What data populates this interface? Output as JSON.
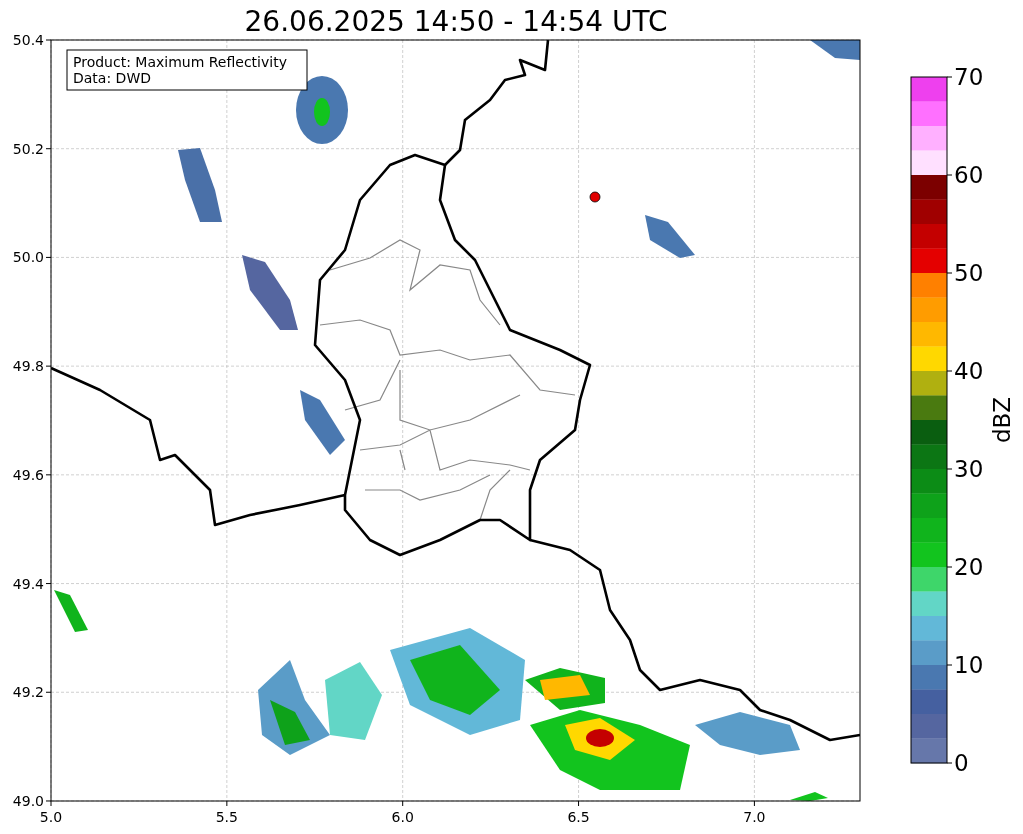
{
  "title": "26.06.2025 14:50 - 14:54 UTC",
  "map": {
    "legend": [
      "Product: Maximum Reflectivity",
      "Data: DWD"
    ],
    "x_ticks": [
      "5.0",
      "5.5",
      "6.0",
      "6.5",
      "7.0"
    ],
    "y_ticks": [
      "50.4",
      "50.2",
      "50.0",
      "49.8",
      "49.6",
      "49.4",
      "49.2",
      "49.0"
    ]
  },
  "colorbar": {
    "label": "dBZ",
    "ticks": [
      "70",
      "60",
      "50",
      "40",
      "30",
      "20",
      "10",
      "0"
    ],
    "segments": [
      {
        "color": "#ee40ee"
      },
      {
        "color": "#ff70ff"
      },
      {
        "color": "#ffb0ff"
      },
      {
        "color": "#ffe0ff"
      },
      {
        "color": "#7c0000"
      },
      {
        "color": "#a00000"
      },
      {
        "color": "#c40000"
      },
      {
        "color": "#e40000"
      },
      {
        "color": "#ff8000"
      },
      {
        "color": "#ff9c00"
      },
      {
        "color": "#ffb800"
      },
      {
        "color": "#ffd800"
      },
      {
        "color": "#b0b010"
      },
      {
        "color": "#4a7a10"
      },
      {
        "color": "#0a5e10"
      },
      {
        "color": "#0c7614"
      },
      {
        "color": "#0c8c16"
      },
      {
        "color": "#0ea21a"
      },
      {
        "color": "#10b41c"
      },
      {
        "color": "#12c41e"
      },
      {
        "color": "#3ed66a"
      },
      {
        "color": "#62d6c6"
      },
      {
        "color": "#62b8d8"
      },
      {
        "color": "#5a9cc8"
      },
      {
        "color": "#4a78b0"
      },
      {
        "color": "#4560a0"
      },
      {
        "color": "#5566a0"
      },
      {
        "color": "#6677aa"
      }
    ]
  }
}
